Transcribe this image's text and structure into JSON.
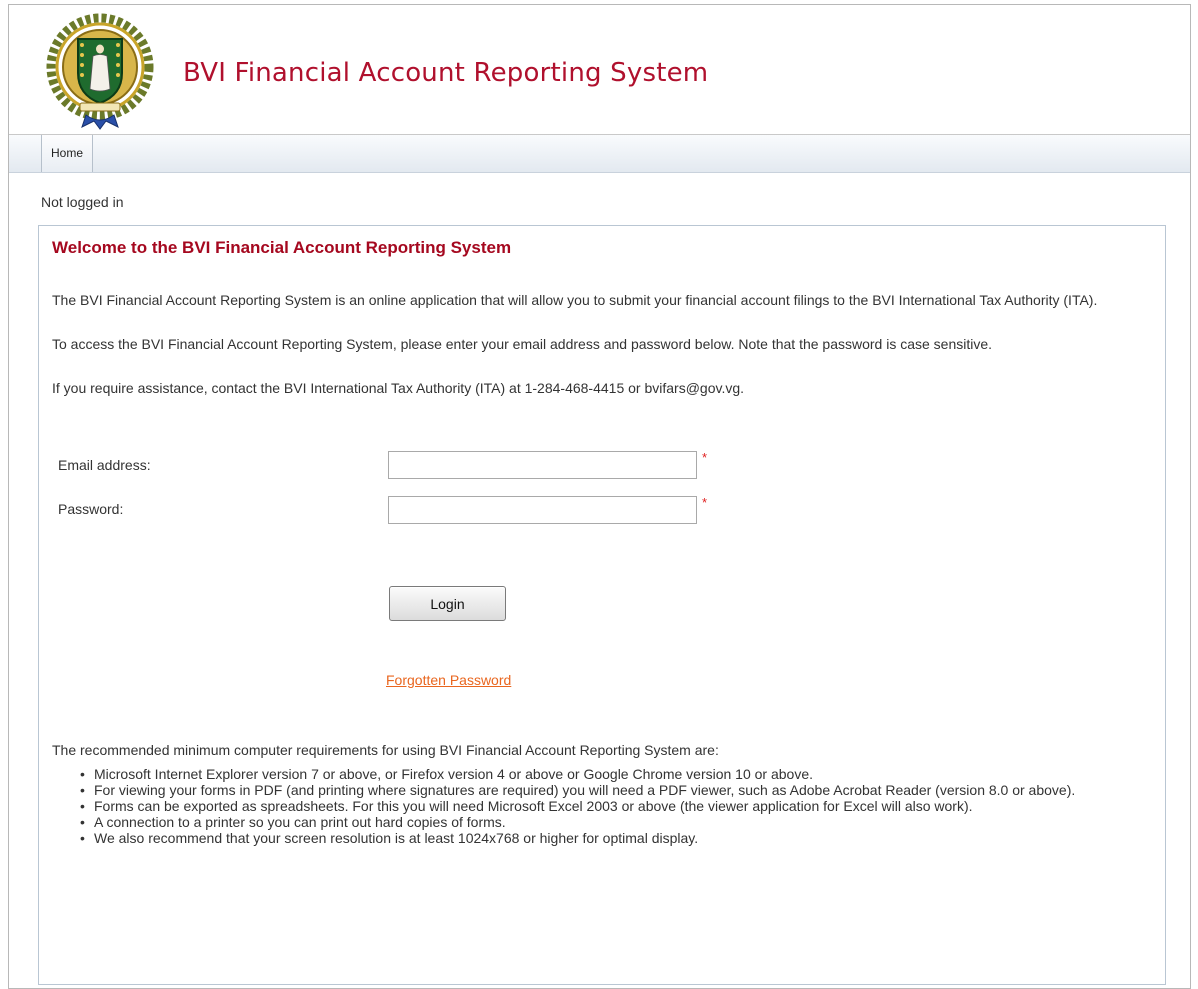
{
  "header": {
    "site_title": "BVI Financial Account Reporting System",
    "crest_icon": "coat-of-arms-icon",
    "brand_color": "#b0102d"
  },
  "nav": {
    "items": [
      {
        "label": "Home"
      }
    ]
  },
  "status": {
    "login_text": "Not logged in"
  },
  "welcome": {
    "title": "Welcome to the BVI Financial Account Reporting System",
    "intro": "The BVI Financial Account Reporting System is an online application that will allow you to submit your financial account filings to the BVI International Tax Authority (ITA).",
    "access": "To access the BVI Financial Account Reporting System, please enter your email address and password below. Note that the password is case sensitive.",
    "assistance": "If you require assistance, contact the BVI International Tax Authority (ITA) at 1-284-468-4415 or bvifars@gov.vg."
  },
  "form": {
    "email_label": "Email address:",
    "email_value": "",
    "password_label": "Password:",
    "password_value": "",
    "required_marker": "*",
    "login_button": "Login",
    "forgot_link": "Forgotten Password"
  },
  "requirements": {
    "heading": "The recommended minimum computer requirements for using BVI Financial Account Reporting System are:",
    "items": [
      "Microsoft Internet Explorer version 7 or above, or Firefox version 4 or above or Google Chrome version 10 or above.",
      "For viewing your forms in PDF (and printing where signatures are required) you will need a PDF viewer, such as Adobe Acrobat Reader (version 8.0 or above).",
      "Forms can be exported as spreadsheets. For this you will need Microsoft Excel 2003 or above (the viewer application for Excel will also work).",
      "A connection to a printer so you can print out hard copies of forms.",
      "We also recommend that your screen resolution is at least 1024x768 or higher for optimal display."
    ]
  }
}
